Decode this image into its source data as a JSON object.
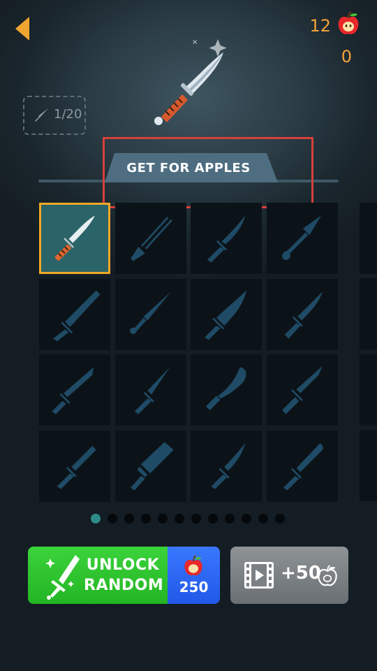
{
  "header": {
    "apple_count": "12",
    "secondary_count": "0"
  },
  "knife_progress": {
    "label": "1/20"
  },
  "action_tab": {
    "label": "GET FOR APPLES"
  },
  "grid": {
    "selected_index": 0,
    "knives": [
      {
        "name": "bowie-knife",
        "locked": false
      },
      {
        "name": "twin-dagger",
        "locked": true
      },
      {
        "name": "combat-knife",
        "locked": true
      },
      {
        "name": "kunai",
        "locked": true
      },
      {
        "name": "serrated-saw",
        "locked": true
      },
      {
        "name": "ring-throwing-knife",
        "locked": true
      },
      {
        "name": "wide-blade",
        "locked": true
      },
      {
        "name": "hunting-knife",
        "locked": true
      },
      {
        "name": "tanto",
        "locked": true
      },
      {
        "name": "spear-dagger",
        "locked": true
      },
      {
        "name": "kukri",
        "locked": true
      },
      {
        "name": "tactical-knife",
        "locked": true
      },
      {
        "name": "short-sword",
        "locked": true
      },
      {
        "name": "cleaver",
        "locked": true
      },
      {
        "name": "hooked-dagger",
        "locked": true
      },
      {
        "name": "baton-knife",
        "locked": true
      }
    ]
  },
  "pagination": {
    "total": 12,
    "active": 0
  },
  "unlock_random": {
    "line1": "UNLOCK",
    "line2": "RANDOM",
    "price": "250"
  },
  "video_reward": {
    "label": "+50"
  },
  "colors": {
    "accent_orange": "#f3a23a",
    "green_button": "#2ec42e",
    "blue_price": "#2c68f4",
    "locked_silhouette": "#1f4b66",
    "highlight_box": "#d8403b"
  }
}
